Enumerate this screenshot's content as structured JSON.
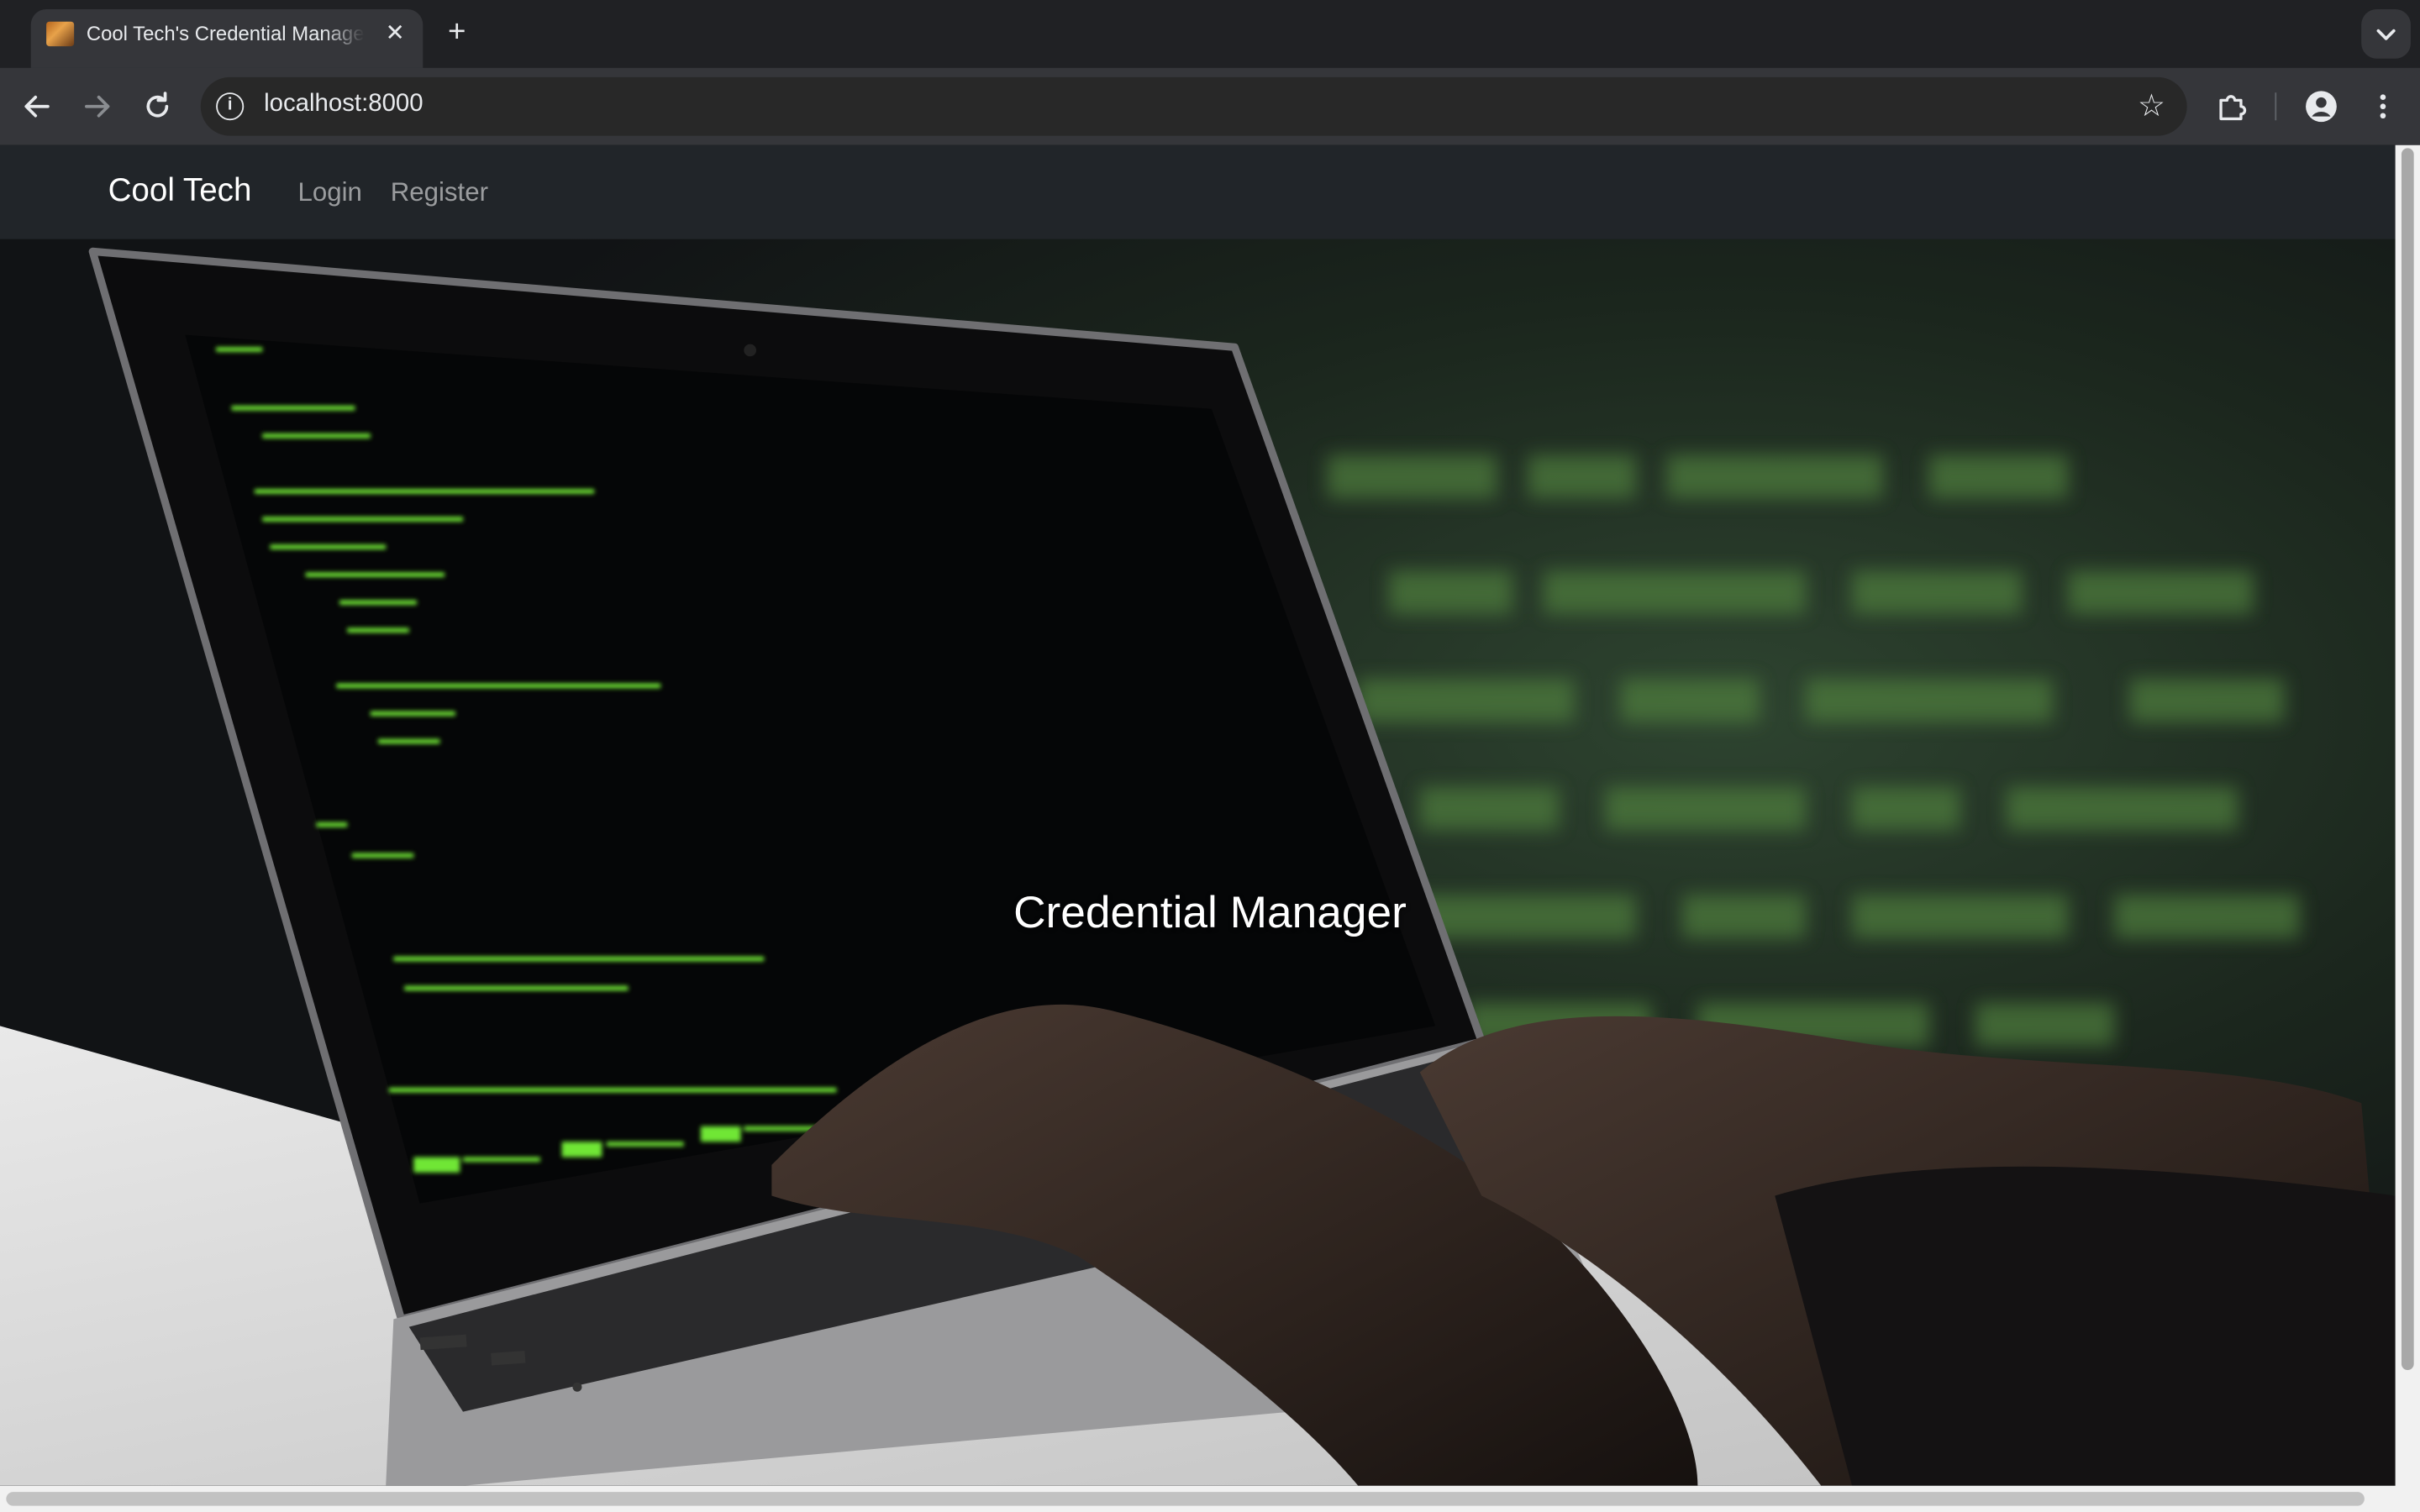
{
  "browser": {
    "tab": {
      "title": "Cool Tech's Credential Manager"
    },
    "address_bar": {
      "url": "localhost:8000"
    }
  },
  "navbar": {
    "brand": "Cool Tech",
    "links": [
      {
        "label": "Login"
      },
      {
        "label": "Register"
      }
    ]
  },
  "hero": {
    "title": "Credential Manager"
  },
  "colors": {
    "navbar_bg": "#212529",
    "code_green": "#7cff3a"
  }
}
